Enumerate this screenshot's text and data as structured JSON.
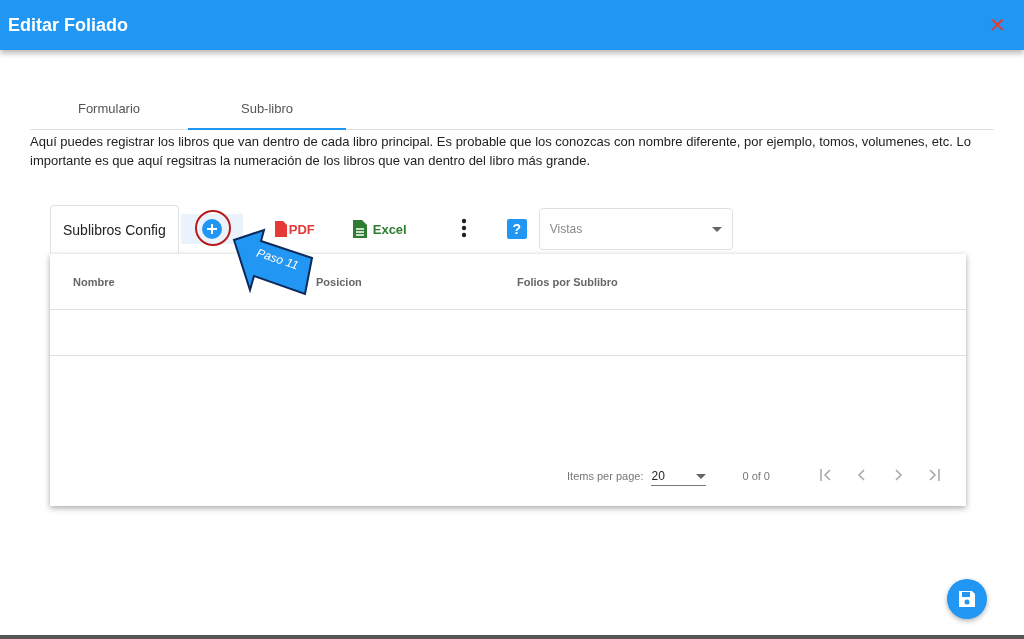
{
  "window": {
    "title": "Editar Foliado",
    "close": "✕"
  },
  "tabs": [
    {
      "label": "Formulario",
      "selected": false
    },
    {
      "label": "Sub-libro",
      "selected": true
    }
  ],
  "description": "Aquí puedes registrar los libros que van dentro de cada libro principal. Es probable que los conozcas con nombre diferente, por ejemplo, tomos, volumenes, etc. Lo importante es que aquí regsitras la numeración de los libros que van dentro del libro más grande.",
  "toolbar": {
    "title": "Sublibros Config",
    "pdf": "PDF",
    "excel": "Excel",
    "help": "?",
    "views": {
      "placeholder": "Vistas"
    }
  },
  "callout": {
    "label": "Paso 11"
  },
  "table": {
    "columns": [
      "Nombre",
      "Posicion",
      "Folios por Sublibro"
    ]
  },
  "paginator": {
    "items_label": "Items per page:",
    "page_size": "20",
    "range": "0 of 0"
  }
}
